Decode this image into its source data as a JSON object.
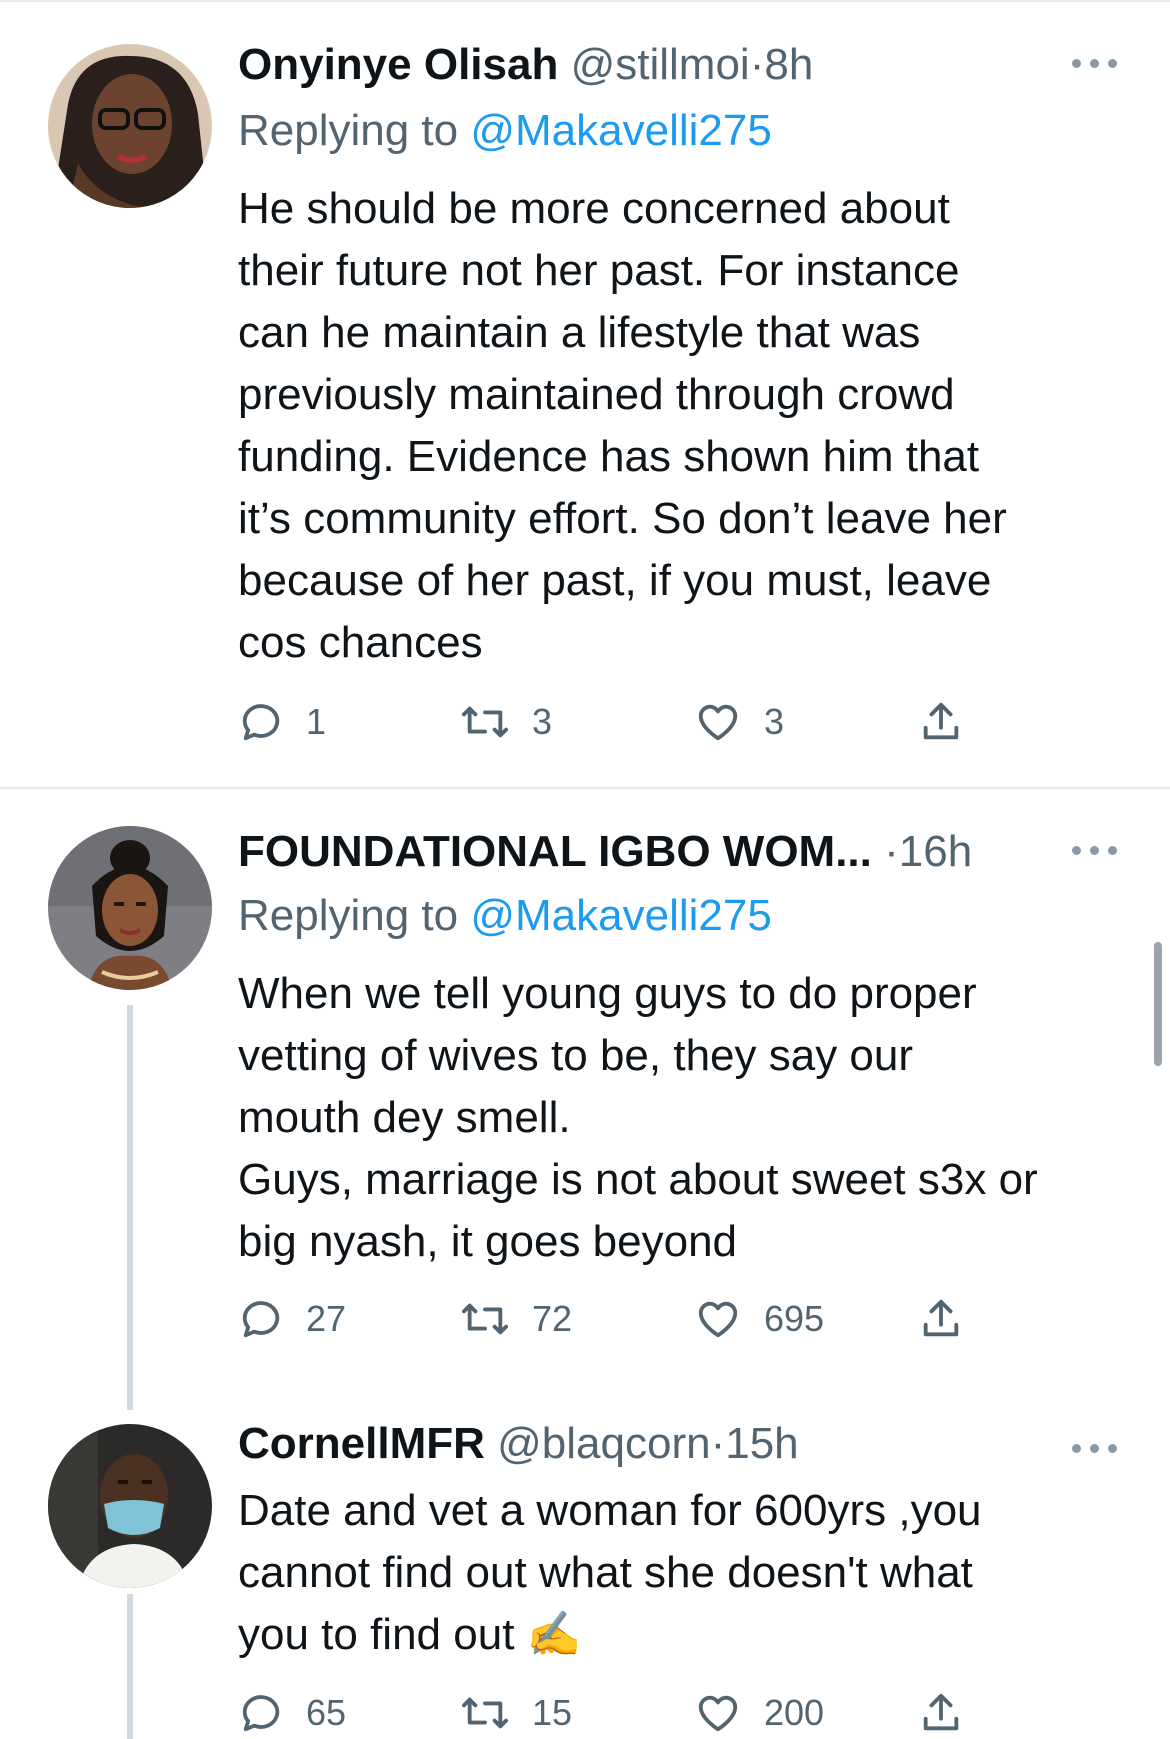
{
  "tweets": [
    {
      "name": "Onyinye Olisah",
      "handle": "@stillmoi",
      "dot": "·",
      "time": "8h",
      "replying_prefix": "Replying to ",
      "replying_to": "@Makavelli275",
      "text": "He should be more concerned about\ntheir future not her past. For instance\ncan he maintain a lifestyle that was\npreviously maintained through crowd\nfunding. Evidence has shown him that\nit’s community effort. So don’t leave her\nbecause of her past, if you must, leave\ncos chances",
      "replies": "1",
      "retweets": "3",
      "likes": "3"
    },
    {
      "name": "FOUNDATIONAL IGBO WOM...",
      "handle": "",
      "dot": "·",
      "time": "16h",
      "replying_prefix": "Replying to ",
      "replying_to": "@Makavelli275",
      "text": "When we tell young guys to do proper\nvetting of wives to be, they say our\nmouth dey smell.\nGuys, marriage is not about sweet s3x or\nbig nyash, it goes beyond",
      "replies": "27",
      "retweets": "72",
      "likes": "695"
    },
    {
      "name": "CornellMFR",
      "handle": "@blaqcorn",
      "dot": "·",
      "time": "15h",
      "text": "Date and vet a woman for 600yrs ,you\ncannot find out what she doesn't what\nyou to find out ✍️",
      "replies": "65",
      "retweets": "15",
      "likes": "200"
    }
  ],
  "colors": {
    "link": "#1d9bf0",
    "secondary_text": "#536471",
    "primary_text": "#0f1419",
    "divider": "#e6ecf0",
    "thread_line": "#cfd9de"
  },
  "icons": [
    "reply-icon",
    "retweet-icon",
    "like-icon",
    "share-icon",
    "more-options-icon"
  ]
}
